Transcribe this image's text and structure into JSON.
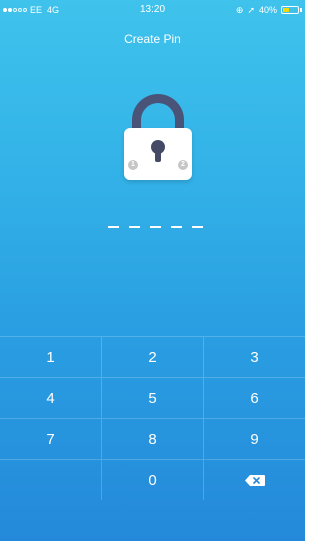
{
  "status_bar": {
    "carrier": "EE",
    "network": "4G",
    "time": "13:20",
    "battery": "40%",
    "battery_level": 0.4,
    "icons": [
      "signal-dots-icon",
      "rotation-lock-icon",
      "location-arrow-icon",
      "battery-icon"
    ]
  },
  "screen": {
    "title": "Create Pin",
    "lock_badges": [
      "1",
      "2"
    ],
    "pin_length": 5
  },
  "keypad": {
    "rows": [
      [
        "1",
        "2",
        "3"
      ],
      [
        "4",
        "5",
        "6"
      ],
      [
        "7",
        "8",
        "9"
      ],
      [
        "",
        "0",
        "backspace-icon"
      ]
    ]
  },
  "colors": {
    "background_top": "#3fc3ec",
    "background_bottom": "#2489da",
    "lock_shackle": "#4a5478",
    "battery_fill": "#f1d90b"
  }
}
